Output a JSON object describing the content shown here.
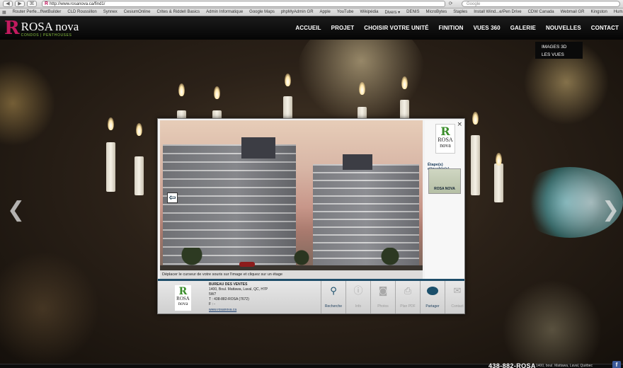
{
  "browser": {
    "back_glyph": "◀",
    "forward_glyph": "▶",
    "reload_glyph": "⟳",
    "share_glyph": "⌘",
    "url": "http://www.rosanova.ca/find1/",
    "search_placeholder": "Google",
    "bookmarks": [
      "Router Perfe...fNetBuilder",
      "CLD Roussillon",
      "Synnex",
      "CesiumOnline",
      "Crites & Riddell Basics",
      "Admin Informatique",
      "Google Maps",
      "phpMyAdmin GR",
      "Apple",
      "YouTube",
      "Wikipédia",
      "Divers ▾",
      "DENIS",
      "MicroBytes",
      "Staples",
      "Install Wind...e/Pen Drive",
      "CDW Canada",
      "Webmail GR",
      "Kingston",
      "Humanistes"
    ]
  },
  "site": {
    "logo_r": "R",
    "logo_name": "ROSA nova",
    "logo_tagline": "CONDOS | PENTHOUSES",
    "nav": [
      "ACCUEIL",
      "PROJET",
      "CHOISIR VOTRE UNITÉ",
      "FINITION",
      "VUES 360",
      "GALERIE",
      "NOUVELLES",
      "CONTACT"
    ],
    "submenu": [
      "IMAGES 3D",
      "LES VUES"
    ],
    "left_arrow": "❮",
    "right_arrow": "❯"
  },
  "modal": {
    "caption": "Déplacer le curseur de votre souris sur l'image et cliquez sur un étage",
    "back_arrow": "⇦",
    "close": "×",
    "side_logo_r": "R",
    "side_logo_name": "ROSA nova",
    "steps_label": "Étape(s) cliquable(s)",
    "step_thumb_label": "ROSA NOVA",
    "footer": {
      "logo_r": "R",
      "logo_name": "ROSA nova",
      "office_title": "BUREAU DES VENTES",
      "address_1": "1400, Boul. Mattawa, Laval, QC, H7P",
      "address_2": "5W7",
      "phone": "T : 438-882-ROSA (7672)",
      "fax": "F : -",
      "website": "www.rosanova.ca"
    },
    "tools": [
      {
        "label": "Recherche",
        "icon": "⚲",
        "active": true
      },
      {
        "label": "Info",
        "icon": "ⓘ",
        "active": false
      },
      {
        "label": "Photos",
        "icon": "◙",
        "active": false
      },
      {
        "label": "Plan PDF",
        "icon": "⎙",
        "active": false
      },
      {
        "label": "Partager",
        "icon": "",
        "active": true
      },
      {
        "label": "Contact",
        "icon": "✉",
        "active": false
      }
    ]
  },
  "statusbar": {
    "left": "",
    "phone": "438-882-ROSA",
    "address": "1400, boul. Mattawa, Laval, Québec",
    "fb": "f"
  },
  "colors": {
    "brand_pink": "#c21a5f",
    "brand_green": "#8bc63f",
    "modal_accent": "#1f4e6a"
  }
}
